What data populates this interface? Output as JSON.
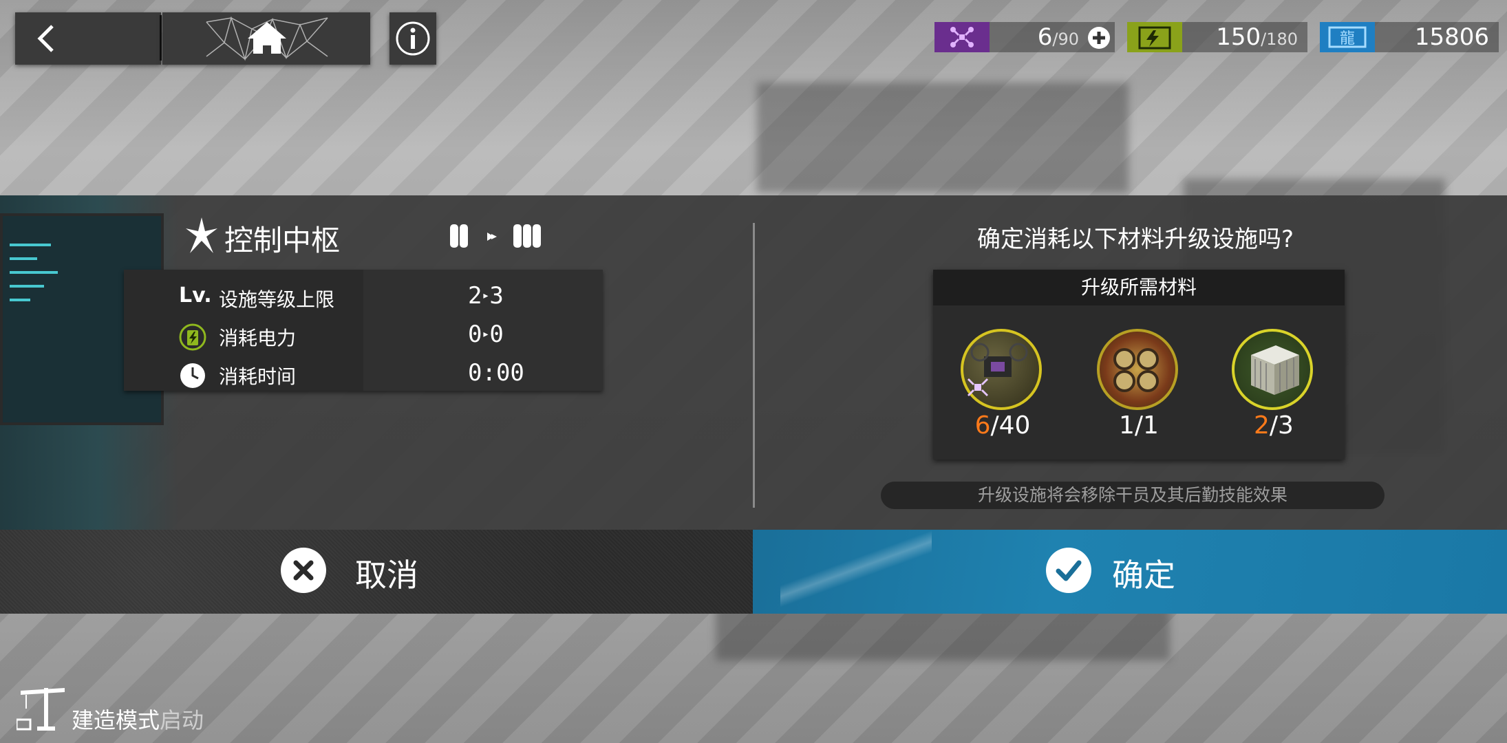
{
  "topbar": {
    "back_icon": "back-arrow-icon",
    "home_icon": "home-icon",
    "info_icon": "info-icon"
  },
  "resources": {
    "drone": {
      "icon": "drone-icon",
      "current": "6",
      "max": "/90",
      "color": "#7b3fa0"
    },
    "power": {
      "icon": "battery-icon",
      "current": "150",
      "max": "/180",
      "color": "#9ab51c"
    },
    "lmd": {
      "icon": "lmd-icon",
      "value": "15806",
      "color": "#2a8fd0"
    }
  },
  "facility": {
    "name": "控制中枢",
    "stats": [
      {
        "label": "设施等级上限",
        "from": "2",
        "to": "3",
        "icon_text": "Lv."
      },
      {
        "label": "消耗电力",
        "from": "0",
        "to": "0"
      },
      {
        "label": "消耗时间",
        "value": "0:00"
      }
    ]
  },
  "confirm": {
    "question": "确定消耗以下材料升级设施吗?",
    "materials_title": "升级所需材料",
    "materials": [
      {
        "name": "drone-material-icon",
        "have": "6",
        "need": "/40"
      },
      {
        "name": "device-material-icon",
        "have": "1",
        "need": "/1"
      },
      {
        "name": "crate-material-icon",
        "have": "2",
        "need": "/3"
      }
    ],
    "warning": "升级设施将会移除干员及其后勤技能效果"
  },
  "buttons": {
    "cancel": "取消",
    "ok": "确定"
  },
  "build_mode": {
    "label": "建造模式",
    "state": "启动"
  }
}
